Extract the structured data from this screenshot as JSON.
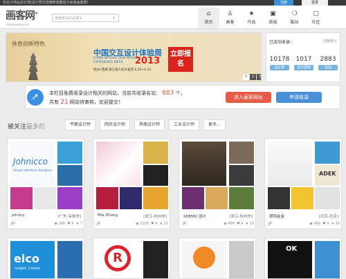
{
  "topbar": {
    "text": "找设计师@设计师|设计师交流推荐收藏名片就来画客网！",
    "register": "注册",
    "login": "登录"
  },
  "header": {
    "logo": "画客网",
    "logo_mark": "®",
    "logo_url": "huakewang.com",
    "search_placeholder": "搜索要找的关键字",
    "nav": [
      {
        "label": "首页",
        "icon": "home-icon",
        "glyph": "⌂"
      },
      {
        "label": "画客",
        "icon": "user-icon",
        "glyph": "♙"
      },
      {
        "label": "作品",
        "icon": "star-icon",
        "glyph": "★"
      },
      {
        "label": "商城",
        "icon": "shop-icon",
        "glyph": "▣"
      },
      {
        "label": "酷站",
        "icon": "drop-icon",
        "glyph": "❍"
      },
      {
        "label": "社区",
        "icon": "chat-icon",
        "glyph": "▢"
      }
    ]
  },
  "banner": {
    "tag": "休息创新特色",
    "title": "中国交互设计体验周",
    "en": "CHINA INTERACTION DESIGN EXPERIENCE WEEK",
    "year": "2013",
    "location": "杭州•西湖 浙江省人民大会堂 6.20~6.23",
    "cta": "立即报名",
    "pages": [
      "1",
      "2",
      "3"
    ]
  },
  "stats": {
    "head": "已成功收录：",
    "link": "注册领入",
    "items": [
      {
        "num": "10178",
        "label": "设计师"
      },
      {
        "num": "1017",
        "label": "设计团体"
      },
      {
        "num": "2883",
        "label": "名站"
      }
    ]
  },
  "notice": {
    "line1_pre": "本栏目免费收录设计相关的网站，当前共收录名站：",
    "line1_count": "883",
    "line1_post": "个，",
    "line2_pre": "共有",
    "line2_count": "21",
    "line2_post": "网站待审核，欢迎提交！",
    "submit": "进入画客网址",
    "apply": "申请收录"
  },
  "filters": {
    "label": "被关注",
    "label_dim": "最多的",
    "chips": [
      "平面设计师",
      "网页设计师",
      "界面设计师",
      "工业设计师",
      "更多..."
    ]
  },
  "cards": [
    {
      "name": "Johnny",
      "loc": "[广东-深圳市]",
      "views": "166",
      "likes": "6",
      "favs": "7"
    },
    {
      "name": "Mia Zhang",
      "loc": "[浙江-杭州市]",
      "views": "3109",
      "likes": "4",
      "favs": "12"
    },
    {
      "name": "SHEMO 设计",
      "loc": "[浙江-杭州市]",
      "views": "466",
      "likes": "4",
      "favs": "19"
    },
    {
      "name": "缪阳金金",
      "loc": "[北京-北京]",
      "views": "466",
      "likes": "4",
      "favs": "19"
    }
  ],
  "card1_art": {
    "brand": "Johnicco",
    "sub": "Visual interface designer"
  },
  "card4_art": {
    "brand": "ADEK"
  },
  "row2_art": [
    {
      "brand": "eico",
      "sub": "Insight. Create"
    },
    {
      "brand": "R"
    },
    {
      "brand": ""
    },
    {
      "brand": "OK"
    }
  ],
  "colors": {
    "accent": "#3b8fd6",
    "cta_red": "#e55b48",
    "topbar": "#3a3a3a"
  }
}
